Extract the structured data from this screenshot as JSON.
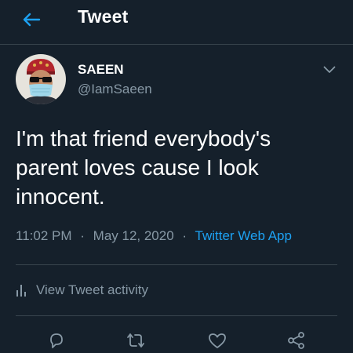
{
  "header": {
    "title": "Tweet",
    "back_icon": "arrow-left-icon"
  },
  "author": {
    "display_name": "SAEEN",
    "handle": "@IamSaeen"
  },
  "tweet": {
    "text": "I'm that friend everybody's parent loves cause I look innocent.",
    "time": "11:02 PM",
    "date": "May 12, 2020",
    "separator": "·",
    "source": "Twitter Web App"
  },
  "activity": {
    "label": "View Tweet activity",
    "icon": "bar-chart-icon"
  },
  "actions": [
    "reply-icon",
    "retweet-icon",
    "like-icon",
    "share-icon"
  ],
  "colors": {
    "background": "#15202b",
    "accent": "#1da1f2",
    "secondary_text": "#8899a6",
    "divider": "#38444d"
  }
}
